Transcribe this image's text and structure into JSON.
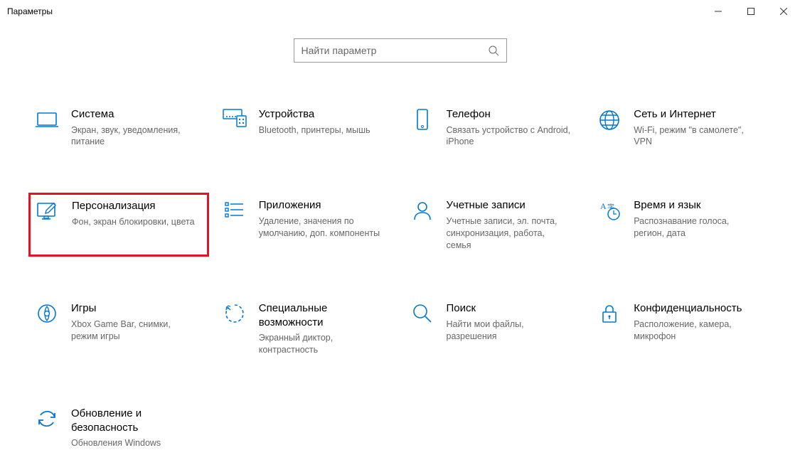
{
  "window": {
    "title": "Параметры"
  },
  "search": {
    "placeholder": "Найти параметр"
  },
  "tiles": [
    {
      "title": "Система",
      "desc": "Экран, звук, уведомления, питание"
    },
    {
      "title": "Устройства",
      "desc": "Bluetooth, принтеры, мышь"
    },
    {
      "title": "Телефон",
      "desc": "Связать устройство с Android, iPhone"
    },
    {
      "title": "Сеть и Интернет",
      "desc": "Wi-Fi, режим \"в самолете\", VPN"
    },
    {
      "title": "Персонализация",
      "desc": "Фон, экран блокировки, цвета"
    },
    {
      "title": "Приложения",
      "desc": "Удаление, значения по умолчанию, доп. компоненты"
    },
    {
      "title": "Учетные записи",
      "desc": "Учетные записи, эл. почта, синхронизация, работа, семья"
    },
    {
      "title": "Время и язык",
      "desc": "Распознавание голоса, регион, дата"
    },
    {
      "title": "Игры",
      "desc": "Xbox Game Bar, снимки, режим игры"
    },
    {
      "title": "Специальные возможности",
      "desc": "Экранный диктор, контрастность"
    },
    {
      "title": "Поиск",
      "desc": "Найти мои файлы, разрешения"
    },
    {
      "title": "Конфиденциальность",
      "desc": "Расположение, камера, микрофон"
    },
    {
      "title": "Обновление и безопасность",
      "desc": "Обновления Windows"
    }
  ]
}
